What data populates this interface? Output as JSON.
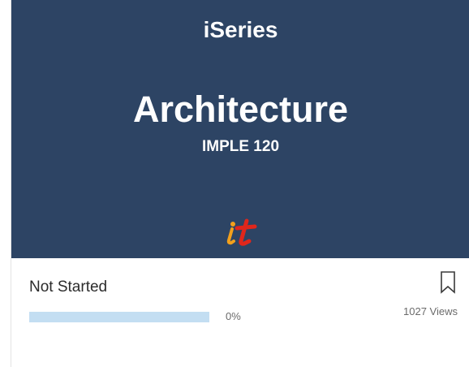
{
  "card": {
    "series_label": "iSeries",
    "title": "Architecture",
    "course_code": "IMPLE 120",
    "logo_text": "it",
    "status": "Not Started",
    "progress_percent": 0,
    "progress_label": "0%",
    "views": "1027 Views",
    "icons": {
      "logo": "it-logo-icon",
      "bookmark": "bookmark-icon"
    },
    "colors": {
      "banner": "#2d4464",
      "progress_track": "#c3def2",
      "logo_i": "#f2a01c",
      "logo_t": "#e0261b"
    }
  }
}
